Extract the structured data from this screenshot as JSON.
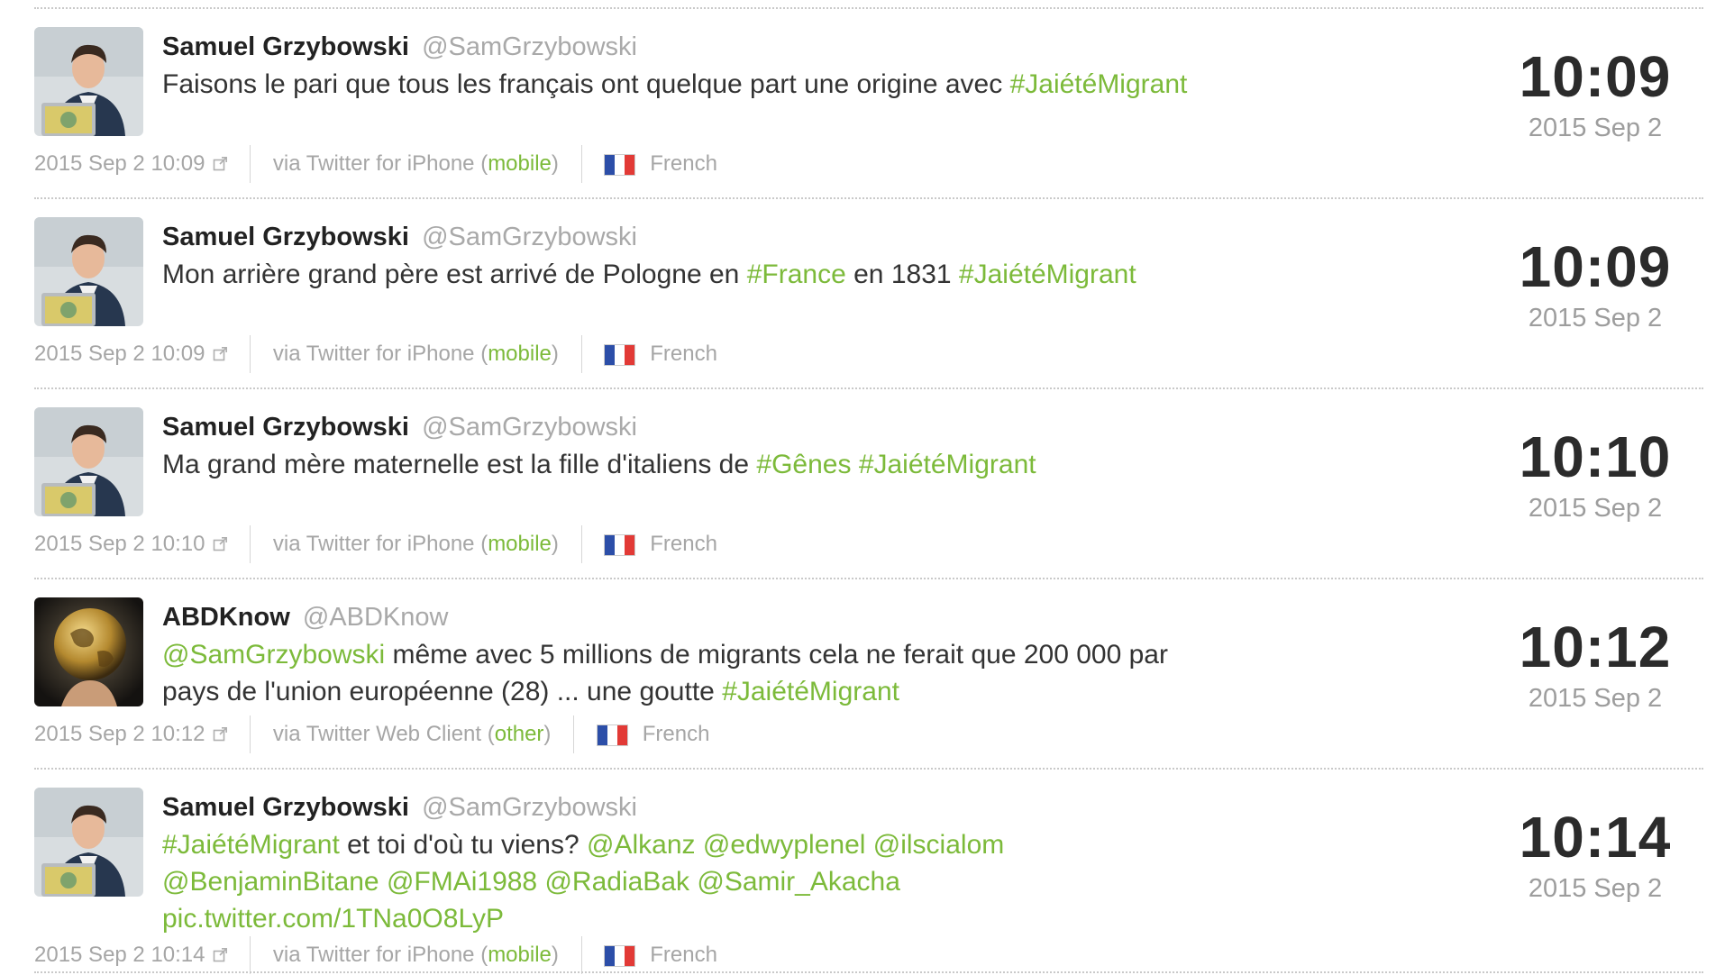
{
  "colors": {
    "link": "#7cba3a",
    "name": "#222222",
    "muted": "#a6a6a6",
    "clock": "#2b2b2b"
  },
  "tweets": [
    {
      "author": {
        "name": "Samuel Grzybowski",
        "handle": "@SamGrzybowski",
        "avatar": "avatar-photo"
      },
      "body": [
        {
          "text": "Faisons le pari que tous les français ont quelque part une origine avec ",
          "link": false
        },
        {
          "text": "#JaiétéMigrant",
          "link": true
        }
      ],
      "timestamp": "2015 Sep 2 10:09",
      "source_prefix": "via Twitter for iPhone (",
      "source_type": "mobile",
      "source_suffix": ")",
      "language": "French",
      "flag": "france-flag",
      "clock_time": "10:09",
      "clock_date": "2015 Sep 2"
    },
    {
      "author": {
        "name": "Samuel Grzybowski",
        "handle": "@SamGrzybowski",
        "avatar": "avatar-photo"
      },
      "body": [
        {
          "text": "Mon arrière grand père est arrivé de Pologne en ",
          "link": false
        },
        {
          "text": "#France",
          "link": true
        },
        {
          "text": " en 1831 ",
          "link": false
        },
        {
          "text": "#JaiétéMigrant",
          "link": true
        }
      ],
      "timestamp": "2015 Sep 2 10:09",
      "source_prefix": "via Twitter for iPhone (",
      "source_type": "mobile",
      "source_suffix": ")",
      "language": "French",
      "flag": "france-flag",
      "clock_time": "10:09",
      "clock_date": "2015 Sep 2"
    },
    {
      "author": {
        "name": "Samuel Grzybowski",
        "handle": "@SamGrzybowski",
        "avatar": "avatar-photo"
      },
      "body": [
        {
          "text": "Ma grand mère maternelle est la fille d'italiens de ",
          "link": false
        },
        {
          "text": "#Gênes",
          "link": true
        },
        {
          "text": " ",
          "link": false
        },
        {
          "text": "#JaiétéMigrant",
          "link": true
        }
      ],
      "timestamp": "2015 Sep 2 10:10",
      "source_prefix": "via Twitter for iPhone (",
      "source_type": "mobile",
      "source_suffix": ")",
      "language": "French",
      "flag": "france-flag",
      "clock_time": "10:10",
      "clock_date": "2015 Sep 2"
    },
    {
      "author": {
        "name": "ABDKnow",
        "handle": "@ABDKnow",
        "avatar": "globe-avatar"
      },
      "body": [
        {
          "text": "@SamGrzybowski",
          "link": true
        },
        {
          "text": " même avec 5 millions de migrants cela ne ferait que 200 000 par pays de l'union européenne (28) ... une goutte ",
          "link": false
        },
        {
          "text": "#JaiétéMigrant",
          "link": true
        }
      ],
      "timestamp": "2015 Sep 2 10:12",
      "source_prefix": "via Twitter Web Client (",
      "source_type": "other",
      "source_suffix": ")",
      "language": "French",
      "flag": "france-flag",
      "clock_time": "10:12",
      "clock_date": "2015 Sep 2"
    },
    {
      "author": {
        "name": "Samuel Grzybowski",
        "handle": "@SamGrzybowski",
        "avatar": "avatar-photo"
      },
      "body": [
        {
          "text": "#JaiétéMigrant",
          "link": true
        },
        {
          "text": " et toi d'où tu viens? ",
          "link": false
        },
        {
          "text": "@Alkanz",
          "link": true
        },
        {
          "text": " ",
          "link": false
        },
        {
          "text": "@edwyplenel",
          "link": true
        },
        {
          "text": " ",
          "link": false
        },
        {
          "text": "@ilscialom",
          "link": true
        },
        {
          "text": " ",
          "link": false
        },
        {
          "text": "@BenjaminBitane",
          "link": true
        },
        {
          "text": " ",
          "link": false
        },
        {
          "text": "@FMAi1988",
          "link": true
        },
        {
          "text": " ",
          "link": false
        },
        {
          "text": "@RadiaBak",
          "link": true
        },
        {
          "text": " ",
          "link": false
        },
        {
          "text": "@Samir_Akacha",
          "link": true
        },
        {
          "text": " ",
          "link": false
        },
        {
          "text": "pic.twitter.com/1TNa0O8LyP",
          "link": true
        }
      ],
      "timestamp": "2015 Sep 2 10:14",
      "source_prefix": "via Twitter for iPhone (",
      "source_type": "mobile",
      "source_suffix": ")",
      "language": "French",
      "flag": "france-flag",
      "clock_time": "10:14",
      "clock_date": "2015 Sep 2"
    }
  ]
}
